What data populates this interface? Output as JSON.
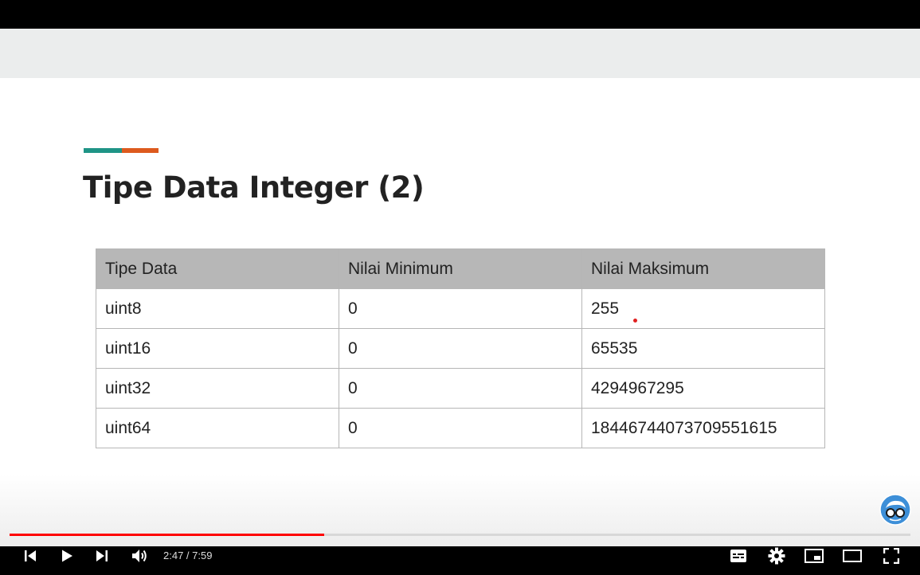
{
  "slide": {
    "title": "Tipe Data Integer (2)",
    "accent_colors": [
      "#1f9486",
      "#dd5a1e"
    ]
  },
  "table": {
    "headers": [
      "Tipe Data",
      "Nilai Minimum",
      "Nilai Maksimum"
    ],
    "rows": [
      [
        "uint8",
        "0",
        "255"
      ],
      [
        "uint16",
        "0",
        "65535"
      ],
      [
        "uint32",
        "0",
        "4294967295"
      ],
      [
        "uint64",
        "0",
        "18446744073709551615"
      ]
    ]
  },
  "player": {
    "time_current": "2:47",
    "time_separator": " / ",
    "time_total": "7:59",
    "progress_fraction": 0.349,
    "buffered_fraction": 0.6,
    "accent_color": "#ff0000",
    "icons": [
      "previous-icon",
      "play-icon",
      "next-icon",
      "volume-icon",
      "subtitles-icon",
      "settings-icon",
      "miniplayer-icon",
      "theater-mode-icon",
      "fullscreen-icon",
      "channel-watermark-icon"
    ]
  }
}
